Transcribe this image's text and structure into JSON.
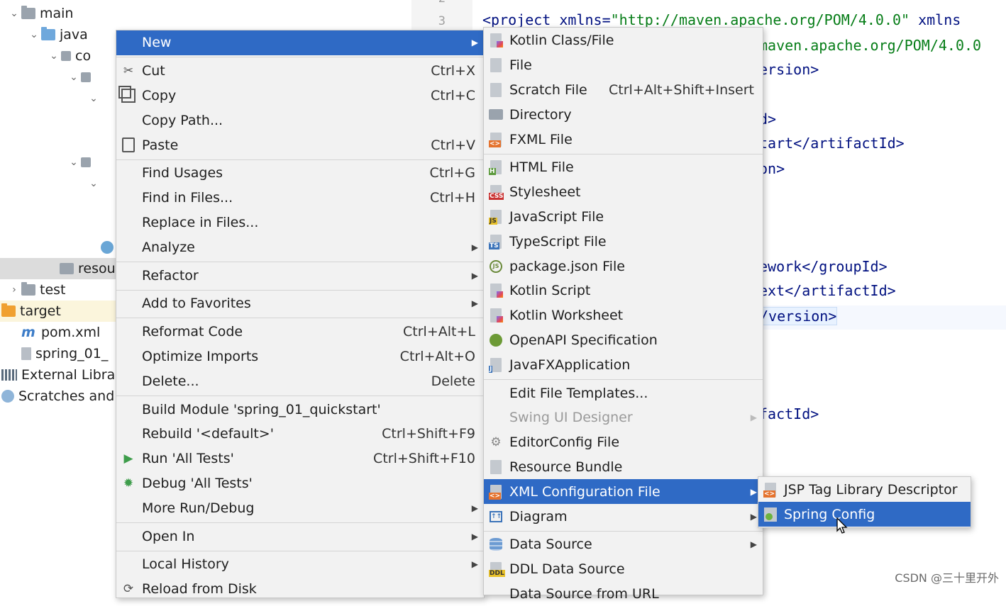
{
  "tree": {
    "items": [
      {
        "label": "main",
        "arrow": "⌄",
        "icon": "folder-icon"
      },
      {
        "label": "java",
        "arrow": "⌄",
        "icon": "source-folder-icon"
      },
      {
        "label": "co",
        "arrow": "⌄",
        "icon": "package-icon"
      },
      {
        "label": "",
        "arrow": "⌄",
        "icon": "package-icon"
      },
      {
        "label": "",
        "arrow": "⌄",
        "icon": ""
      },
      {
        "label": "",
        "arrow": "⌄",
        "icon": "package-icon"
      },
      {
        "label": "",
        "arrow": "⌄",
        "icon": ""
      },
      {
        "label": "",
        "arrow": "",
        "icon": "class-icon"
      },
      {
        "label": "resou",
        "arrow": "",
        "icon": "resources-folder-icon"
      },
      {
        "label": "test",
        "arrow": "›",
        "icon": "folder-icon"
      },
      {
        "label": "target",
        "arrow": "›",
        "icon": "target-folder-icon"
      },
      {
        "label": "pom.xml",
        "arrow": "",
        "icon": "maven-icon"
      },
      {
        "label": "spring_01_",
        "arrow": "",
        "icon": "file-icon"
      },
      {
        "label": "External Libra",
        "arrow": "",
        "icon": "libraries-icon"
      },
      {
        "label": "Scratches and",
        "arrow": "",
        "icon": "scratches-icon"
      }
    ]
  },
  "editor": {
    "line_numbers": [
      "2",
      "3"
    ],
    "lines": [
      {
        "parts": [
          [
            "tag",
            "<project xmlns="
          ],
          [
            "str",
            "\"http://maven.apache.org/POM/4.0.0\""
          ],
          [
            "tag",
            " xmlns"
          ]
        ]
      },
      {
        "parts": [
          [
            "str",
            "maven.apache.org/POM/4.0.0"
          ]
        ]
      },
      {
        "parts": [
          [
            "tag",
            "ersion>"
          ]
        ]
      },
      {
        "parts": [
          [
            "tag",
            "d>"
          ]
        ]
      },
      {
        "parts": [
          [
            "tag",
            "tart</artifactId>"
          ]
        ]
      },
      {
        "parts": [
          [
            "tag",
            "on>"
          ]
        ]
      },
      {
        "parts": [
          [
            "tag",
            "ework</groupId>"
          ]
        ]
      },
      {
        "parts": [
          [
            "tag",
            "ext</artifactId>"
          ]
        ]
      },
      {
        "parts": [
          [
            "tag",
            "/version>"
          ]
        ]
      },
      {
        "parts": [
          [
            "tag",
            "factId>"
          ]
        ]
      }
    ]
  },
  "context_menu": {
    "items": [
      {
        "label": "New",
        "shortcut": "",
        "submenu": true,
        "icon": "",
        "highlight": true
      },
      {
        "sep": true
      },
      {
        "label": "Cut",
        "shortcut": "Ctrl+X",
        "icon": "scissors-icon"
      },
      {
        "label": "Copy",
        "shortcut": "Ctrl+C",
        "icon": "copy-icon"
      },
      {
        "label": "Copy Path...",
        "shortcut": "",
        "icon": ""
      },
      {
        "label": "Paste",
        "shortcut": "Ctrl+V",
        "icon": "paste-icon"
      },
      {
        "sep": true
      },
      {
        "label": "Find Usages",
        "shortcut": "Ctrl+G",
        "icon": ""
      },
      {
        "label": "Find in Files...",
        "shortcut": "Ctrl+H",
        "icon": ""
      },
      {
        "label": "Replace in Files...",
        "shortcut": "",
        "icon": ""
      },
      {
        "label": "Analyze",
        "shortcut": "",
        "submenu": true,
        "icon": ""
      },
      {
        "sep": true
      },
      {
        "label": "Refactor",
        "shortcut": "",
        "submenu": true,
        "icon": ""
      },
      {
        "sep": true
      },
      {
        "label": "Add to Favorites",
        "shortcut": "",
        "submenu": true,
        "icon": ""
      },
      {
        "sep": true
      },
      {
        "label": "Reformat Code",
        "shortcut": "Ctrl+Alt+L",
        "icon": ""
      },
      {
        "label": "Optimize Imports",
        "shortcut": "Ctrl+Alt+O",
        "icon": ""
      },
      {
        "label": "Delete...",
        "shortcut": "Delete",
        "icon": ""
      },
      {
        "sep": true
      },
      {
        "label": "Build Module 'spring_01_quickstart'",
        "shortcut": "",
        "icon": ""
      },
      {
        "label": "Rebuild '<default>'",
        "shortcut": "Ctrl+Shift+F9",
        "icon": ""
      },
      {
        "label": "Run 'All Tests'",
        "shortcut": "Ctrl+Shift+F10",
        "icon": "run-icon"
      },
      {
        "label": "Debug 'All Tests'",
        "shortcut": "",
        "icon": "debug-icon"
      },
      {
        "label": "More Run/Debug",
        "shortcut": "",
        "submenu": true,
        "icon": ""
      },
      {
        "sep": true
      },
      {
        "label": "Open In",
        "shortcut": "",
        "submenu": true,
        "icon": ""
      },
      {
        "sep": true
      },
      {
        "label": "Local History",
        "shortcut": "",
        "submenu": true,
        "icon": ""
      },
      {
        "label": "Reload from Disk",
        "shortcut": "",
        "icon": "reload-icon"
      }
    ]
  },
  "new_submenu": {
    "items": [
      {
        "label": "Kotlin Class/File",
        "shortcut": "",
        "icon": "kotlin-file-icon"
      },
      {
        "label": "File",
        "shortcut": "",
        "icon": "file-icon"
      },
      {
        "label": "Scratch File",
        "shortcut": "Ctrl+Alt+Shift+Insert",
        "icon": "scratch-file-icon"
      },
      {
        "label": "Directory",
        "shortcut": "",
        "icon": "directory-icon"
      },
      {
        "label": "FXML File",
        "shortcut": "",
        "icon": "fxml-file-icon"
      },
      {
        "sep": true
      },
      {
        "label": "HTML File",
        "shortcut": "",
        "icon": "html-file-icon"
      },
      {
        "label": "Stylesheet",
        "shortcut": "",
        "icon": "css-file-icon"
      },
      {
        "label": "JavaScript File",
        "shortcut": "",
        "icon": "js-file-icon"
      },
      {
        "label": "TypeScript File",
        "shortcut": "",
        "icon": "ts-file-icon"
      },
      {
        "label": "package.json File",
        "shortcut": "",
        "icon": "package-json-icon"
      },
      {
        "label": "Kotlin Script",
        "shortcut": "",
        "icon": "kotlin-script-icon"
      },
      {
        "label": "Kotlin Worksheet",
        "shortcut": "",
        "icon": "kotlin-worksheet-icon"
      },
      {
        "label": "OpenAPI Specification",
        "shortcut": "",
        "icon": "openapi-icon"
      },
      {
        "label": "JavaFXApplication",
        "shortcut": "",
        "icon": "javafx-icon"
      },
      {
        "sep": true
      },
      {
        "label": "Edit File Templates...",
        "shortcut": "",
        "icon": ""
      },
      {
        "label": "Swing UI Designer",
        "shortcut": "",
        "submenu": true,
        "disabled": true,
        "icon": ""
      },
      {
        "label": "EditorConfig File",
        "shortcut": "",
        "icon": "gear-icon"
      },
      {
        "label": "Resource Bundle",
        "shortcut": "",
        "icon": "resource-bundle-icon"
      },
      {
        "label": "XML Configuration File",
        "shortcut": "",
        "submenu": true,
        "highlight": true,
        "icon": "xml-file-icon"
      },
      {
        "label": "Diagram",
        "shortcut": "",
        "submenu": true,
        "icon": "diagram-icon"
      },
      {
        "sep": true
      },
      {
        "label": "Data Source",
        "shortcut": "",
        "submenu": true,
        "icon": "database-icon"
      },
      {
        "label": "DDL Data Source",
        "shortcut": "",
        "icon": "ddl-icon"
      },
      {
        "label": "Data Source from URL",
        "shortcut": "",
        "icon": ""
      }
    ]
  },
  "xml_submenu": {
    "items": [
      {
        "label": "JSP Tag Library Descriptor",
        "icon": "xml-file-icon"
      },
      {
        "label": "Spring Config",
        "icon": "spring-config-icon",
        "highlight": true
      }
    ]
  },
  "watermark": "CSDN @三十里开外",
  "colors": {
    "highlight": "#2f6ac5",
    "menu_bg": "#f2f2f2",
    "tag": "#001080",
    "string": "#067d17"
  }
}
